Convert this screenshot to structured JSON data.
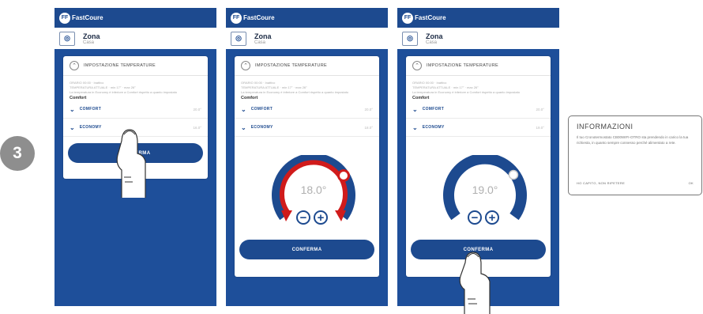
{
  "step_number": "3",
  "app": {
    "logo_letters": "FF",
    "logo_text": "FastCoure"
  },
  "colors": {
    "brand_blue": "#1d4a8f",
    "heating_red": "#d01b1b",
    "badge_gray": "#8e8e8e"
  },
  "screens": [
    {
      "zone_icon": "◎",
      "zone_title": "Zona",
      "zone_subtitle": "Casa",
      "settings_title": "IMPOSTAZIONE TEMPERATURE",
      "info_lines": [
        "ORARIO 00:00 · Inattivo",
        "TEMPERATURA ATTUALE · min 17° · max 26°",
        "La temperatura in Economy è inferiore a Comfort rispetto a quanto impostato"
      ],
      "active_mode": "Comfort",
      "modes": [
        {
          "label": "COMFORT",
          "temp": "20.0°"
        },
        {
          "label": "ECONOMY",
          "temp": "16.0°"
        }
      ],
      "confirm_label": "CONFERMA"
    },
    {
      "zone_icon": "◎",
      "zone_title": "Zona",
      "zone_subtitle": "Casa",
      "settings_title": "IMPOSTAZIONE TEMPERATURE",
      "info_lines": [
        "ORARIO 00:00 · Inattivo",
        "TEMPERATURA ATTUALE · min 17° · max 26°",
        "La temperatura in Economy è inferiore a Comfort rispetto a quanto impostato"
      ],
      "active_mode": "Comfort",
      "modes": [
        {
          "label": "COMFORT",
          "temp": "20.0°"
        },
        {
          "label": "ECONOMY",
          "temp": "18.0°"
        }
      ],
      "dial_temp": "18.0°",
      "minus": "−",
      "plus": "+",
      "confirm_label": "CONFERMA"
    },
    {
      "zone_icon": "◎",
      "zone_title": "Zona",
      "zone_subtitle": "Casa",
      "settings_title": "IMPOSTAZIONE TEMPERATURE",
      "info_lines": [
        "ORARIO 00:00 · Inattivo",
        "TEMPERATURA ATTUALE · min 17° · max 26°",
        "La temperatura in Economy è inferiore a Comfort rispetto a quanto impostato"
      ],
      "active_mode": "Comfort",
      "modes": [
        {
          "label": "COMFORT",
          "temp": "20.0°"
        },
        {
          "label": "ECONOMY",
          "temp": "19.0°"
        }
      ],
      "dial_temp": "19.0°",
      "minus": "−",
      "plus": "+",
      "confirm_label": "CONFERMA"
    }
  ],
  "info_dialog": {
    "title": "INFORMAZIONI",
    "body": "Il tuo Cronotermostato CB00WIFI-OTRO sta prendendo in carico la tua richiesta, in quanto sempre connesso perché alimentato a rete.",
    "dismiss_label": "HO CAPITO, NON RIPETERE",
    "ok_label": "OK"
  }
}
